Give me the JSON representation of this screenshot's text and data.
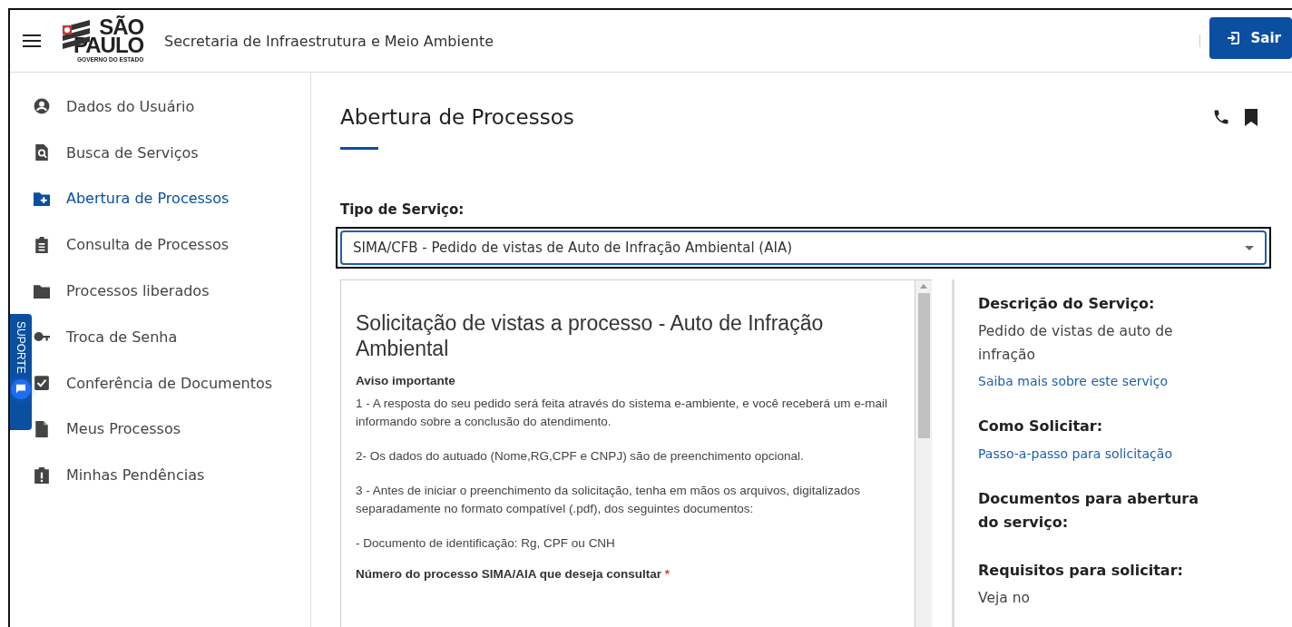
{
  "header": {
    "logo": {
      "line_1": "SÃO",
      "line_2": "PAULO",
      "line_3": "GOVERNO DO ESTADO"
    },
    "title": "Secretaria de Infraestrutura e Meio Ambiente",
    "logout_button": "Sair"
  },
  "sidebar": {
    "items": [
      {
        "label": "Dados do Usuário",
        "selected": false
      },
      {
        "label": "Busca de Serviços",
        "selected": false
      },
      {
        "label": "Abertura de Processos",
        "selected": true
      },
      {
        "label": "Consulta de Processos",
        "selected": false
      },
      {
        "label": "Processos liberados",
        "selected": false
      },
      {
        "label": "Troca de Senha",
        "selected": false
      },
      {
        "label": "Conferência de Documentos",
        "selected": false
      },
      {
        "label": "Meus Processos",
        "selected": false
      },
      {
        "label": "Minhas Pendências",
        "selected": false
      }
    ]
  },
  "support_tab": {
    "label": "SUPORTE"
  },
  "page": {
    "title": "Abertura de Processos",
    "service_type": {
      "label": "Tipo de Serviço:",
      "value": "SIMA/CFB - Pedido de vistas de Auto de Infração Ambiental (AIA)"
    }
  },
  "form_preview": {
    "title": "Solicitação de vistas a processo - Auto de Infração Ambiental",
    "notice_heading": "Aviso importante",
    "paragraphs": [
      [
        "1 - A resposta do seu pedido será feita através do sistema e-ambiente, e você receberá um e-mail informando sobre a conclusão do atendimento."
      ],
      [
        "2- Os dados do autuado (Nome,RG,CPF e CNPJ) são de preenchimento opcional."
      ],
      [
        "3 - Antes de iniciar o preenchimento da solicitação, tenha em mãos os arquivos, digitalizados",
        "separadamente no formato compatível (.pdf), dos seguintes documentos:"
      ],
      [
        "- Documento de identificação: Rg, CPF ou CNH"
      ]
    ],
    "field_label": "Número do processo SIMA/AIA que deseja consultar",
    "required_mark": "*"
  },
  "info_panel": {
    "sections": [
      {
        "heading": "Descrição do Serviço:",
        "text": "Pedido de vistas de auto de infração",
        "link": "Saiba mais sobre este serviço"
      },
      {
        "heading": "Como Solicitar:",
        "link": "Passo-a-passo para solicitação"
      },
      {
        "heading": "Documentos para abertura do serviço:"
      },
      {
        "heading": "Requisitos para solicitar:",
        "text": "Veja no"
      }
    ]
  }
}
